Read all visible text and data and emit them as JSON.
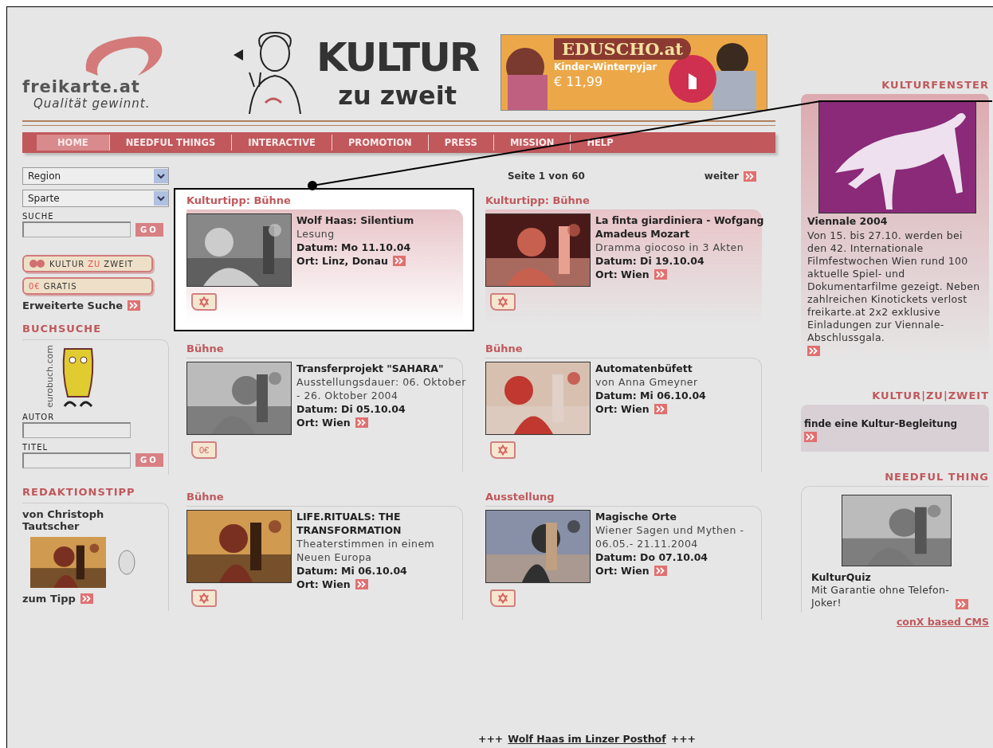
{
  "logo": {
    "name": "freikarte",
    "suffix": ".at",
    "tagline": "Qualität gewinnt."
  },
  "banner": {
    "title": "KULTUR",
    "subtitle": "zu zweit"
  },
  "ad": {
    "brand": "EDUSCHO.at",
    "text": "Kinder-Winterpyjar",
    "price": "€ 11,99"
  },
  "nav": [
    {
      "label": "HOME",
      "selected": true
    },
    {
      "label": "NEEDFUL THINGS",
      "selected": false
    },
    {
      "label": "INTERACTIVE",
      "selected": false
    },
    {
      "label": "PROMOTION",
      "selected": false
    },
    {
      "label": "PRESS",
      "selected": false
    },
    {
      "label": "MISSION",
      "selected": false
    },
    {
      "label": "HELP",
      "selected": false
    }
  ],
  "sidebar": {
    "selects": [
      {
        "value": "Region"
      },
      {
        "value": "Sparte"
      }
    ],
    "search": {
      "label": "SUCHE",
      "button": "GO"
    },
    "kultur_button": {
      "parts": [
        "KULTUR",
        "ZU",
        "ZWEIT"
      ]
    },
    "gratis_button": {
      "prefix": "0€",
      "label": "GRATIS"
    },
    "advanced_search": "Erweiterte Suche",
    "book_search": {
      "heading": "BUCHSUCHE",
      "site": "eurobuch.com",
      "fields": [
        {
          "label": "AUTOR"
        },
        {
          "label": "TITEL"
        }
      ],
      "button": "GO"
    },
    "editor_tip": {
      "heading": "REDAKTIONSTIPP",
      "author": "von Christoph Tautscher",
      "link": "zum Tipp"
    }
  },
  "pager": {
    "text": "Seite 1 von 60",
    "next": "weiter"
  },
  "tips": [
    {
      "category": "Kulturtipp: Bühne",
      "featured": true,
      "highlighted": true,
      "title": "Wolf Haas: Silentium",
      "description": "Lesung",
      "date": "Datum: Mo 11.10.04",
      "place": "Ort: Linz, Donau",
      "badge": {
        "kind": "star"
      }
    },
    {
      "category": "Kulturtipp: Bühne",
      "featured": true,
      "highlighted": false,
      "title": "La finta giardiniera - Wofgang Amadeus Mozart",
      "description": "Dramma giocoso in 3 Akten",
      "date": "Datum: Di 19.10.04",
      "place": "Ort: Wien",
      "badge": {
        "kind": "star"
      }
    },
    {
      "category": "Bühne",
      "featured": false,
      "highlighted": false,
      "title": "Transferprojekt \"SAHARA\"",
      "description": "Ausstellungsdauer: 06. Oktober - 26. Oktober 2004",
      "date": "Datum: Di 05.10.04",
      "place": "Ort: Wien",
      "badge": {
        "kind": "free",
        "label": "0€"
      }
    },
    {
      "category": "Bühne",
      "featured": false,
      "highlighted": false,
      "title": "Automatenbüfett",
      "description": "von Anna Gmeyner",
      "date": "Datum: Mi 06.10.04",
      "place": "Ort: Wien",
      "badge": {
        "kind": "star"
      }
    },
    {
      "category": "Bühne",
      "featured": false,
      "highlighted": false,
      "title": "LIFE.RITUALS: THE TRANSFORMATION",
      "description": "Theaterstimmen in einem Neuen Europa",
      "date": "Datum: Mi 06.10.04",
      "place": "Ort: Wien",
      "badge": {
        "kind": "star"
      }
    },
    {
      "category": "Ausstellung",
      "featured": false,
      "highlighted": false,
      "title": "Magische Orte",
      "description": "Wiener Sagen und Mythen - 06.05.- 21.11.2004",
      "date": "Datum: Do 07.10.04",
      "place": "Ort: Wien",
      "badge": {
        "kind": "star"
      }
    }
  ],
  "kulturfenster": {
    "heading": "KULTURFENSTER",
    "title": "Viennale 2004",
    "text": "Von 15. bis 27.10. werden bei den 42. Internationale Filmfestwochen Wien rund 100 aktuelle Spiel- und Dokumentarfilme gezeigt. Neben zahlreichen Kinotickets verlost freikarte.at 2x2 exklusive Einladungen zur Viennale-Abschlussgala."
  },
  "kultur_zu_zweit": {
    "heading": "KULTUR|ZU|ZWEIT",
    "link": "finde eine Kultur-Begleitung"
  },
  "needful_thing": {
    "heading": "NEEDFUL THING",
    "title": "KulturQuiz",
    "text": "Mit Garantie ohne Telefon-Joker!"
  },
  "cms_link": "conX based CMS",
  "ticker": {
    "prefix": "+++",
    "link": "Wolf Haas im Linzer Posthof",
    "suffix": "+++"
  }
}
